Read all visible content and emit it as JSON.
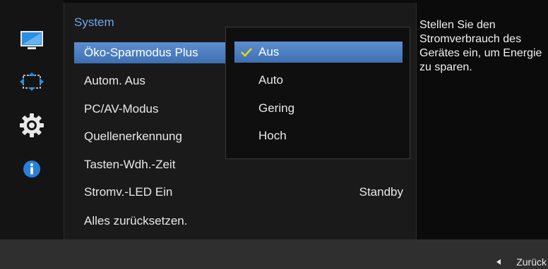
{
  "rail": {
    "items": [
      {
        "icon": "monitor-icon"
      },
      {
        "icon": "position-icon"
      },
      {
        "icon": "gear-icon"
      },
      {
        "icon": "info-icon"
      }
    ]
  },
  "panel": {
    "title": "System",
    "items": [
      {
        "label": "Öko-Sparmodus Plus",
        "value": ""
      },
      {
        "label": "Autom. Aus",
        "value": ""
      },
      {
        "label": "PC/AV-Modus",
        "value": ""
      },
      {
        "label": "Quellenerkennung",
        "value": ""
      },
      {
        "label": "Tasten-Wdh.-Zeit",
        "value": ""
      },
      {
        "label": "Stromv.-LED Ein",
        "value": "Standby"
      },
      {
        "label": "Alles zurücksetzen.",
        "value": ""
      }
    ]
  },
  "submenu": {
    "options": [
      "Aus",
      "Auto",
      "Gering",
      "Hoch"
    ],
    "selected_option": "Aus"
  },
  "help": {
    "text": "Stellen Sie den Stromverbrauch des Gerätes ein, um Energie zu sparen."
  },
  "footer": {
    "back_label": "Zurück"
  },
  "colors": {
    "accent": "#4a7ec4",
    "title_blue": "#6ea6ea",
    "check_yellow": "#e6d21c",
    "info_blue": "#2b7fd9"
  }
}
